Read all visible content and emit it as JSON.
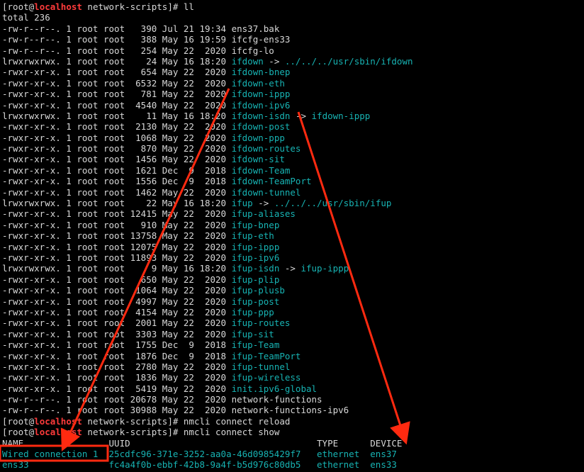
{
  "terminal": {
    "prompt_user": "root",
    "prompt_host": "localhost",
    "prompt_dir": "network-scripts",
    "commands": {
      "ll": "ll",
      "reload": "nmcli connect reload",
      "show": "nmcli connect show"
    },
    "total_line": "total 236",
    "listing": [
      {
        "meta": "-rw-r--r--. 1 root root   390 Jul 21 19:34 ",
        "name": "ens37.bak",
        "cyan": false,
        "link": ""
      },
      {
        "meta": "-rw-r--r--. 1 root root   388 May 16 19:59 ",
        "name": "ifcfg-ens33",
        "cyan": false,
        "link": ""
      },
      {
        "meta": "-rw-r--r--. 1 root root   254 May 22  2020 ",
        "name": "ifcfg-lo",
        "cyan": false,
        "link": ""
      },
      {
        "meta": "lrwxrwxrwx. 1 root root    24 May 16 18:20 ",
        "name": "ifdown",
        "cyan": true,
        "link": "../../../usr/sbin/ifdown"
      },
      {
        "meta": "-rwxr-xr-x. 1 root root   654 May 22  2020 ",
        "name": "ifdown-bnep",
        "cyan": true,
        "link": ""
      },
      {
        "meta": "-rwxr-xr-x. 1 root root  6532 May 22  2020 ",
        "name": "ifdown-eth",
        "cyan": true,
        "link": ""
      },
      {
        "meta": "-rwxr-xr-x. 1 root root   781 May 22  2020 ",
        "name": "ifdown-ippp",
        "cyan": true,
        "link": ""
      },
      {
        "meta": "-rwxr-xr-x. 1 root root  4540 May 22  2020 ",
        "name": "ifdown-ipv6",
        "cyan": true,
        "link": ""
      },
      {
        "meta": "lrwxrwxrwx. 1 root root    11 May 16 18:20 ",
        "name": "ifdown-isdn",
        "cyan": true,
        "link": "ifdown-ippp"
      },
      {
        "meta": "-rwxr-xr-x. 1 root root  2130 May 22  2020 ",
        "name": "ifdown-post",
        "cyan": true,
        "link": ""
      },
      {
        "meta": "-rwxr-xr-x. 1 root root  1068 May 22  2020 ",
        "name": "ifdown-ppp",
        "cyan": true,
        "link": ""
      },
      {
        "meta": "-rwxr-xr-x. 1 root root   870 May 22  2020 ",
        "name": "ifdown-routes",
        "cyan": true,
        "link": ""
      },
      {
        "meta": "-rwxr-xr-x. 1 root root  1456 May 22  2020 ",
        "name": "ifdown-sit",
        "cyan": true,
        "link": ""
      },
      {
        "meta": "-rwxr-xr-x. 1 root root  1621 Dec  9  2018 ",
        "name": "ifdown-Team",
        "cyan": true,
        "link": ""
      },
      {
        "meta": "-rwxr-xr-x. 1 root root  1556 Dec  9  2018 ",
        "name": "ifdown-TeamPort",
        "cyan": true,
        "link": ""
      },
      {
        "meta": "-rwxr-xr-x. 1 root root  1462 May 22  2020 ",
        "name": "ifdown-tunnel",
        "cyan": true,
        "link": ""
      },
      {
        "meta": "lrwxrwxrwx. 1 root root    22 May 16 18:20 ",
        "name": "ifup",
        "cyan": true,
        "link": "../../../usr/sbin/ifup"
      },
      {
        "meta": "-rwxr-xr-x. 1 root root 12415 May 22  2020 ",
        "name": "ifup-aliases",
        "cyan": true,
        "link": ""
      },
      {
        "meta": "-rwxr-xr-x. 1 root root   910 May 22  2020 ",
        "name": "ifup-bnep",
        "cyan": true,
        "link": ""
      },
      {
        "meta": "-rwxr-xr-x. 1 root root 13758 May 22  2020 ",
        "name": "ifup-eth",
        "cyan": true,
        "link": ""
      },
      {
        "meta": "-rwxr-xr-x. 1 root root 12075 May 22  2020 ",
        "name": "ifup-ippp",
        "cyan": true,
        "link": ""
      },
      {
        "meta": "-rwxr-xr-x. 1 root root 11893 May 22  2020 ",
        "name": "ifup-ipv6",
        "cyan": true,
        "link": ""
      },
      {
        "meta": "lrwxrwxrwx. 1 root root     9 May 16 18:20 ",
        "name": "ifup-isdn",
        "cyan": true,
        "link": "ifup-ippp"
      },
      {
        "meta": "-rwxr-xr-x. 1 root root   650 May 22  2020 ",
        "name": "ifup-plip",
        "cyan": true,
        "link": ""
      },
      {
        "meta": "-rwxr-xr-x. 1 root root  1064 May 22  2020 ",
        "name": "ifup-plusb",
        "cyan": true,
        "link": ""
      },
      {
        "meta": "-rwxr-xr-x. 1 root root  4997 May 22  2020 ",
        "name": "ifup-post",
        "cyan": true,
        "link": ""
      },
      {
        "meta": "-rwxr-xr-x. 1 root root  4154 May 22  2020 ",
        "name": "ifup-ppp",
        "cyan": true,
        "link": ""
      },
      {
        "meta": "-rwxr-xr-x. 1 root root  2001 May 22  2020 ",
        "name": "ifup-routes",
        "cyan": true,
        "link": ""
      },
      {
        "meta": "-rwxr-xr-x. 1 root root  3303 May 22  2020 ",
        "name": "ifup-sit",
        "cyan": true,
        "link": ""
      },
      {
        "meta": "-rwxr-xr-x. 1 root root  1755 Dec  9  2018 ",
        "name": "ifup-Team",
        "cyan": true,
        "link": ""
      },
      {
        "meta": "-rwxr-xr-x. 1 root root  1876 Dec  9  2018 ",
        "name": "ifup-TeamPort",
        "cyan": true,
        "link": ""
      },
      {
        "meta": "-rwxr-xr-x. 1 root root  2780 May 22  2020 ",
        "name": "ifup-tunnel",
        "cyan": true,
        "link": ""
      },
      {
        "meta": "-rwxr-xr-x. 1 root root  1836 May 22  2020 ",
        "name": "ifup-wireless",
        "cyan": true,
        "link": ""
      },
      {
        "meta": "-rwxr-xr-x. 1 root root  5419 May 22  2020 ",
        "name": "init.ipv6-global",
        "cyan": true,
        "link": ""
      },
      {
        "meta": "-rw-r--r--. 1 root root 20678 May 22  2020 ",
        "name": "network-functions",
        "cyan": false,
        "link": ""
      },
      {
        "meta": "-rw-r--r--. 1 root root 30988 May 22  2020 ",
        "name": "network-functions-ipv6",
        "cyan": false,
        "link": ""
      }
    ],
    "nmcli_table": {
      "headers": {
        "name": "NAME",
        "uuid": "UUID",
        "type": "TYPE",
        "device": "DEVICE"
      },
      "rows": [
        {
          "name": "Wired connection 1",
          "uuid": "25cdfc96-371e-3252-aa0a-46d0985429f7",
          "type": "ethernet",
          "device": "ens37"
        },
        {
          "name": "ens33",
          "uuid": "fc4a4f0b-ebbf-42b8-9a4f-b5d976c80db5",
          "type": "ethernet",
          "device": "ens33"
        }
      ]
    },
    "colors": {
      "background": "#000000",
      "text": "#d8d8d8",
      "cyan": "#17b3b3",
      "hostname_red": "#ff3b3b",
      "annotation_red": "#ff2a10"
    }
  }
}
